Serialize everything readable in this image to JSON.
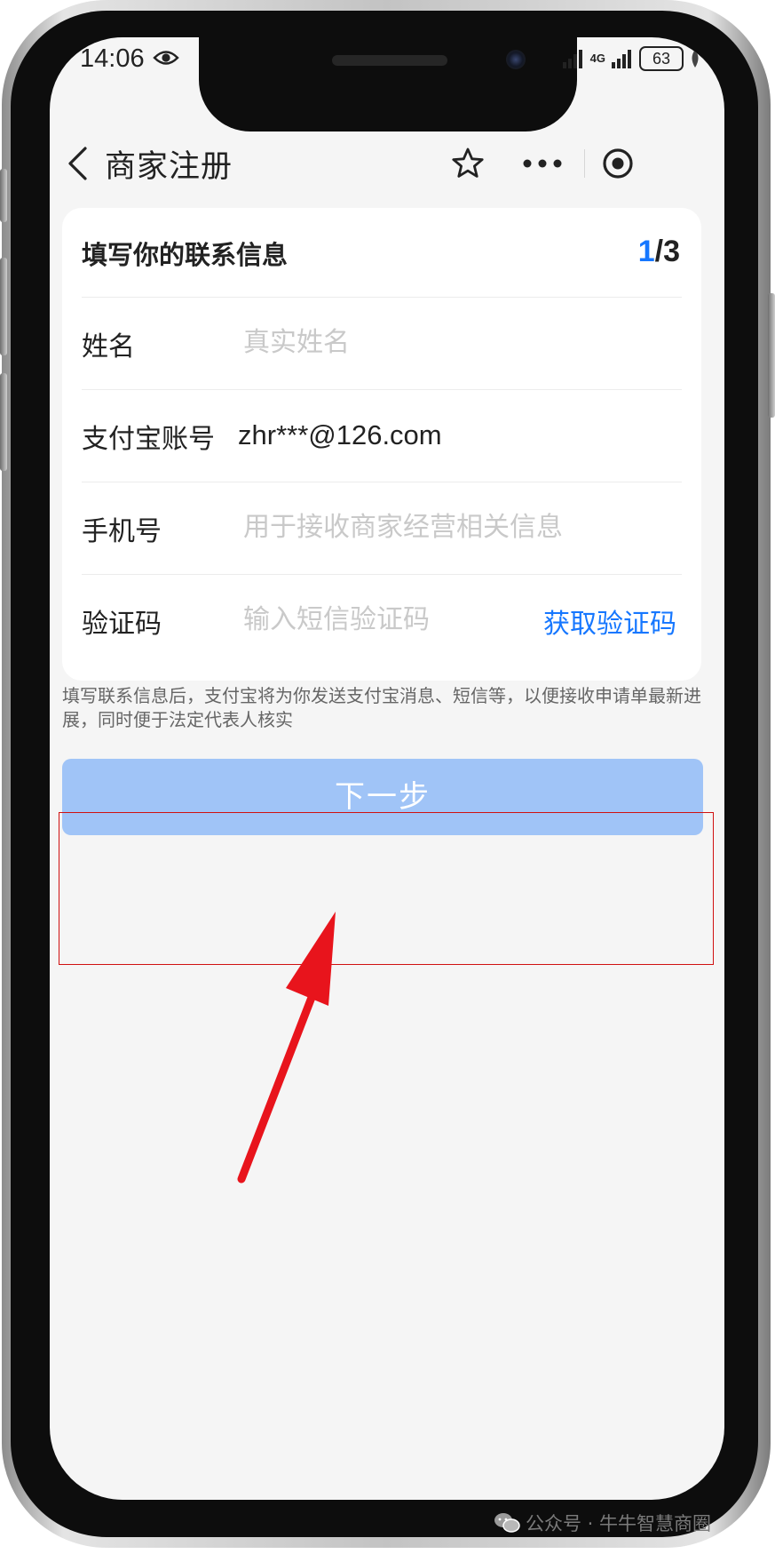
{
  "status_bar": {
    "time": "14:06",
    "network": "4G",
    "battery": "63"
  },
  "nav": {
    "title": "商家注册"
  },
  "form": {
    "title": "填写你的联系信息",
    "step_current": "1",
    "step_total": "/3",
    "fields": [
      {
        "label": "姓名",
        "placeholder": "真实姓名",
        "value": ""
      },
      {
        "label": "支付宝账号",
        "placeholder": "",
        "value": "zhr***@126.com"
      },
      {
        "label": "手机号",
        "placeholder": "用于接收商家经营相关信息",
        "value": ""
      },
      {
        "label": "验证码",
        "placeholder": "输入短信验证码",
        "value": ""
      }
    ],
    "get_code_label": "获取验证码"
  },
  "tip": "填写联系信息后，支付宝将为你发送支付宝消息、短信等，以便接收申请单最新进展，同时便于法定代表人核实",
  "next_button": "下一步",
  "watermark": "公众号 · 牛牛智慧商圈",
  "colors": {
    "accent": "#1677ff",
    "button_disabled": "#a0c4f7",
    "page_bg": "#f5f5f5",
    "annotation": "#e8141c"
  },
  "icons": [
    "back-icon",
    "star-icon",
    "more-icon",
    "target-icon",
    "eye-icon",
    "wechat-icon",
    "arrow-annotation"
  ]
}
